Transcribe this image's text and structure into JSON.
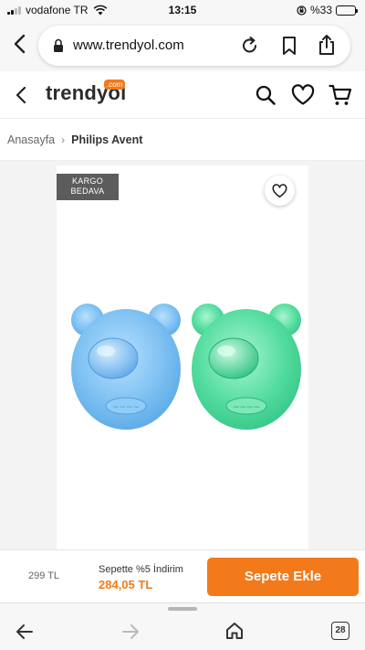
{
  "status_bar": {
    "carrier": "vodafone TR",
    "time": "13:15",
    "battery": "%33",
    "battery_level_fraction": 0.33
  },
  "browser": {
    "url": "www.trendyol.com",
    "tab_count": "28"
  },
  "site_header": {
    "logo_text": "trendyol",
    "logo_badge": ".com",
    "brand_color": "#f27a1a"
  },
  "breadcrumb": {
    "home": "Anasayfa",
    "current": "Philips Avent"
  },
  "product": {
    "badge_line1": "KARGO",
    "badge_line2": "BEDAVA",
    "image_description_colors": [
      "#6ab4ef",
      "#3fd89a"
    ]
  },
  "purchase_bar": {
    "old_price": "299 TL",
    "promo_text": "Sepette %5 İndirim",
    "new_price": "284,05 TL",
    "add_to_cart_label": "Sepete Ekle"
  }
}
